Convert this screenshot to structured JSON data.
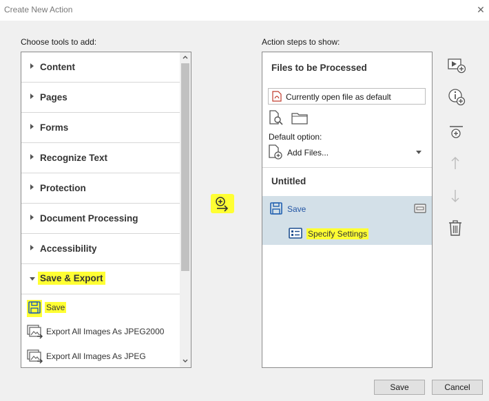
{
  "window": {
    "title": "Create New Action"
  },
  "left": {
    "heading": "Choose tools to add:",
    "categories": [
      {
        "label": "Content"
      },
      {
        "label": "Pages"
      },
      {
        "label": "Forms"
      },
      {
        "label": "Recognize Text"
      },
      {
        "label": "Protection"
      },
      {
        "label": "Document Processing"
      },
      {
        "label": "Accessibility"
      },
      {
        "label": "Save & Export",
        "expanded": true,
        "highlighted": true
      }
    ],
    "tools": [
      {
        "label": "Save",
        "icon": "save-icon",
        "highlighted": true
      },
      {
        "label": "Export All Images As JPEG2000",
        "icon": "export-images-icon"
      },
      {
        "label": "Export All Images As JPEG",
        "icon": "export-images-icon"
      }
    ]
  },
  "add_arrow": {
    "icon": "add-to-action-icon",
    "highlighted": true
  },
  "right": {
    "heading": "Action steps to show:",
    "files_section": {
      "title": "Files to be Processed",
      "file_dropdown": "Currently open file as default",
      "default_option_label": "Default option:",
      "default_option_value": "Add Files..."
    },
    "untitled_section": {
      "title": "Untitled"
    },
    "step": {
      "label": "Save",
      "settings_label": "Specify Settings",
      "settings_highlighted": true
    }
  },
  "side_toolbar": [
    {
      "icon": "add-prompt-icon"
    },
    {
      "icon": "add-instruction-icon"
    },
    {
      "icon": "add-panel-separator-icon"
    },
    {
      "icon": "move-up-icon",
      "disabled": true
    },
    {
      "icon": "move-down-icon",
      "disabled": true
    },
    {
      "icon": "delete-icon"
    }
  ],
  "footer": {
    "save": "Save",
    "cancel": "Cancel"
  },
  "colors": {
    "highlight": "#ffff33",
    "selected_row": "#d3e0e8",
    "link_blue": "#2255a4"
  }
}
